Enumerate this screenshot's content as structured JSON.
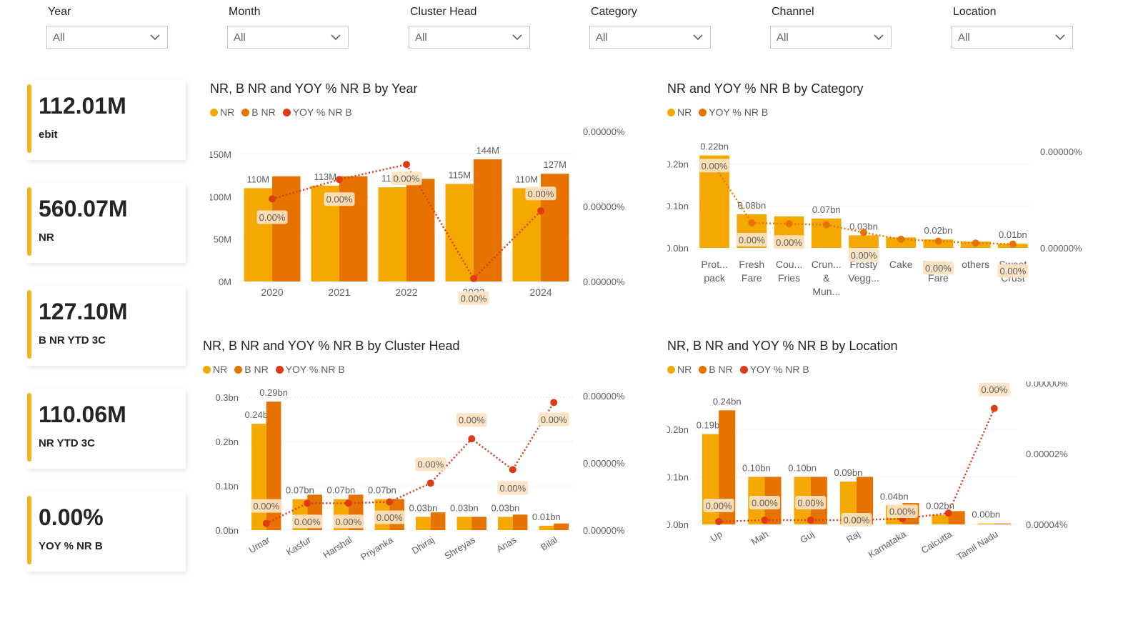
{
  "colors": {
    "nr": "#f5a800",
    "bnr": "#e67300",
    "yoy": "#de3b14",
    "accent": "#f2b120",
    "grid": "#d9d9d9",
    "axis": "#605e5c"
  },
  "slicers": [
    {
      "label": "Year",
      "value": "All"
    },
    {
      "label": "Month",
      "value": "All"
    },
    {
      "label": "Cluster Head",
      "value": "All"
    },
    {
      "label": "Category",
      "value": "All"
    },
    {
      "label": "Channel",
      "value": "All"
    },
    {
      "label": "Location",
      "value": "All"
    }
  ],
  "cards": [
    {
      "value": "112.01M",
      "label": "ebit"
    },
    {
      "value": "560.07M",
      "label": "NR"
    },
    {
      "value": "127.10M",
      "label": "B NR YTD 3C"
    },
    {
      "value": "110.06M",
      "label": "NR YTD 3C"
    },
    {
      "value": "0.00%",
      "label": "YOY % NR B"
    }
  ],
  "chart_data": [
    {
      "id": "year",
      "type": "bar",
      "title": "NR, B NR and YOY % NR B by Year",
      "legend": [
        "NR",
        "B NR",
        "YOY % NR B"
      ],
      "categories": [
        "2020",
        "2021",
        "2022",
        "2023",
        "2024"
      ],
      "series": [
        {
          "name": "NR",
          "values": [
            110,
            113,
            111,
            115,
            110
          ],
          "labels": [
            "110M",
            "113M",
            "111M",
            "115M",
            "110M"
          ]
        },
        {
          "name": "B NR",
          "values": [
            124,
            124,
            121,
            144,
            127
          ],
          "labels": [
            "",
            "",
            "",
            "144M",
            "127M"
          ]
        },
        {
          "name": "YOY % NR B",
          "values": [
            0.55,
            0.68,
            0.78,
            0.02,
            0.47
          ],
          "labels": [
            "0.00%",
            "0.00%",
            "0.00%",
            "0.00%",
            "0.00%"
          ]
        }
      ],
      "y_ticks": [
        "0M",
        "50M",
        "100M",
        "150M"
      ],
      "ylim": [
        0,
        160
      ],
      "y2_ticks": [
        "0.00000%",
        "0.00000%",
        "0.00000%"
      ]
    },
    {
      "id": "category",
      "type": "bar",
      "title": "NR and YOY % NR B by Category",
      "legend": [
        "NR",
        "YOY % NR B"
      ],
      "categories": [
        "Prot... pack",
        "Fresh Fare",
        "Cou... Fries",
        "Crun... & Mun...",
        "Frosty Vegg...",
        "Cake",
        "Frost... Fare",
        "others",
        "Sweet Crust"
      ],
      "series": [
        {
          "name": "NR",
          "values": [
            0.22,
            0.08,
            0.075,
            0.07,
            0.03,
            0.025,
            0.02,
            0.015,
            0.01
          ],
          "labels": [
            "0.22bn",
            "0.08bn",
            "",
            "0.07bn",
            "0.03bn",
            "",
            "0.02bn",
            "",
            "0.01bn"
          ]
        },
        {
          "name": "YOY % NR B",
          "values": [
            0.85,
            0.26,
            0.25,
            0.24,
            0.16,
            0.09,
            0.07,
            0.05,
            0.04
          ],
          "labels": [
            "0.00%",
            "0.00%",
            "0.00%",
            "",
            "0.00%",
            "",
            "0.00%",
            "",
            "0.00%"
          ]
        }
      ],
      "y_ticks": [
        "0.0bn",
        "0.1bn",
        "0.2bn"
      ],
      "ylim": [
        0,
        0.26
      ],
      "y2_ticks": [
        "0.00000%",
        "0.00000%"
      ]
    },
    {
      "id": "cluster",
      "type": "bar",
      "title": "NR, B NR and YOY % NR B by Cluster Head",
      "legend": [
        "NR",
        "B NR",
        "YOY % NR B"
      ],
      "categories": [
        "Umar",
        "Kasfur",
        "Harshal",
        "Priyanka",
        "Dhiraj",
        "Shreyas",
        "Anas",
        "Bilal"
      ],
      "series": [
        {
          "name": "NR",
          "values": [
            0.24,
            0.07,
            0.07,
            0.07,
            0.03,
            0.03,
            0.03,
            0.01
          ],
          "labels": [
            "0.24bn",
            "0.07bn",
            "0.07bn",
            "0.07bn",
            "0.03bn",
            "0.03bn",
            "0.03bn",
            "0.01bn"
          ]
        },
        {
          "name": "B NR",
          "values": [
            0.29,
            0.08,
            0.08,
            0.07,
            0.04,
            0.03,
            0.035,
            0.015
          ],
          "labels": [
            "0.29bn",
            "",
            "",
            "",
            "",
            "",
            "",
            ""
          ]
        },
        {
          "name": "YOY % NR B",
          "values": [
            0.05,
            0.2,
            0.2,
            0.21,
            0.35,
            0.68,
            0.45,
            0.95
          ],
          "labels": [
            "0.00%",
            "0.00%",
            "0.00%",
            "0.00%",
            "0.00%",
            "0.00%",
            "0.00%",
            "0.00%"
          ]
        }
      ],
      "y_ticks": [
        "0.0bn",
        "0.1bn",
        "0.2bn",
        "0.3bn"
      ],
      "ylim": [
        0,
        0.3
      ],
      "y2_ticks": [
        "0.00000%",
        "0.00000%",
        "0.00000%"
      ]
    },
    {
      "id": "location",
      "type": "bar",
      "title": "NR, B NR and YOY % NR B by Location",
      "legend": [
        "NR",
        "B NR",
        "YOY % NR B"
      ],
      "categories": [
        "Up",
        "Mah",
        "Guj",
        "Raj",
        "Karnataka",
        "Calcutta",
        "Tamil Nadu"
      ],
      "series": [
        {
          "name": "NR",
          "values": [
            0.19,
            0.1,
            0.1,
            0.09,
            0.04,
            0.02,
            0.002
          ],
          "labels": [
            "0.19bn",
            "0.10bn",
            "0.10bn",
            "0.09bn",
            "0.04bn",
            "0.02bn",
            "0.00bn"
          ]
        },
        {
          "name": "B NR",
          "values": [
            0.24,
            0.1,
            0.1,
            0.1,
            0.045,
            0.028,
            0.002
          ],
          "labels": [
            "0.24bn",
            "",
            "",
            "",
            "",
            "",
            ""
          ]
        },
        {
          "name": "YOY % NR B",
          "values": [
            0.02,
            0.03,
            0.03,
            0.03,
            0.04,
            0.08,
            0.82
          ],
          "labels": [
            "0.00%",
            "0.00%",
            "0.00%",
            "0.00%",
            "0.00%",
            "",
            "0.00%"
          ]
        }
      ],
      "y_ticks": [
        "0.0bn",
        "0.1bn",
        "0.2bn"
      ],
      "ylim": [
        0,
        0.26
      ],
      "y2_ticks": [
        "0.00000%",
        "0.00002%",
        "0.00004%"
      ]
    }
  ]
}
